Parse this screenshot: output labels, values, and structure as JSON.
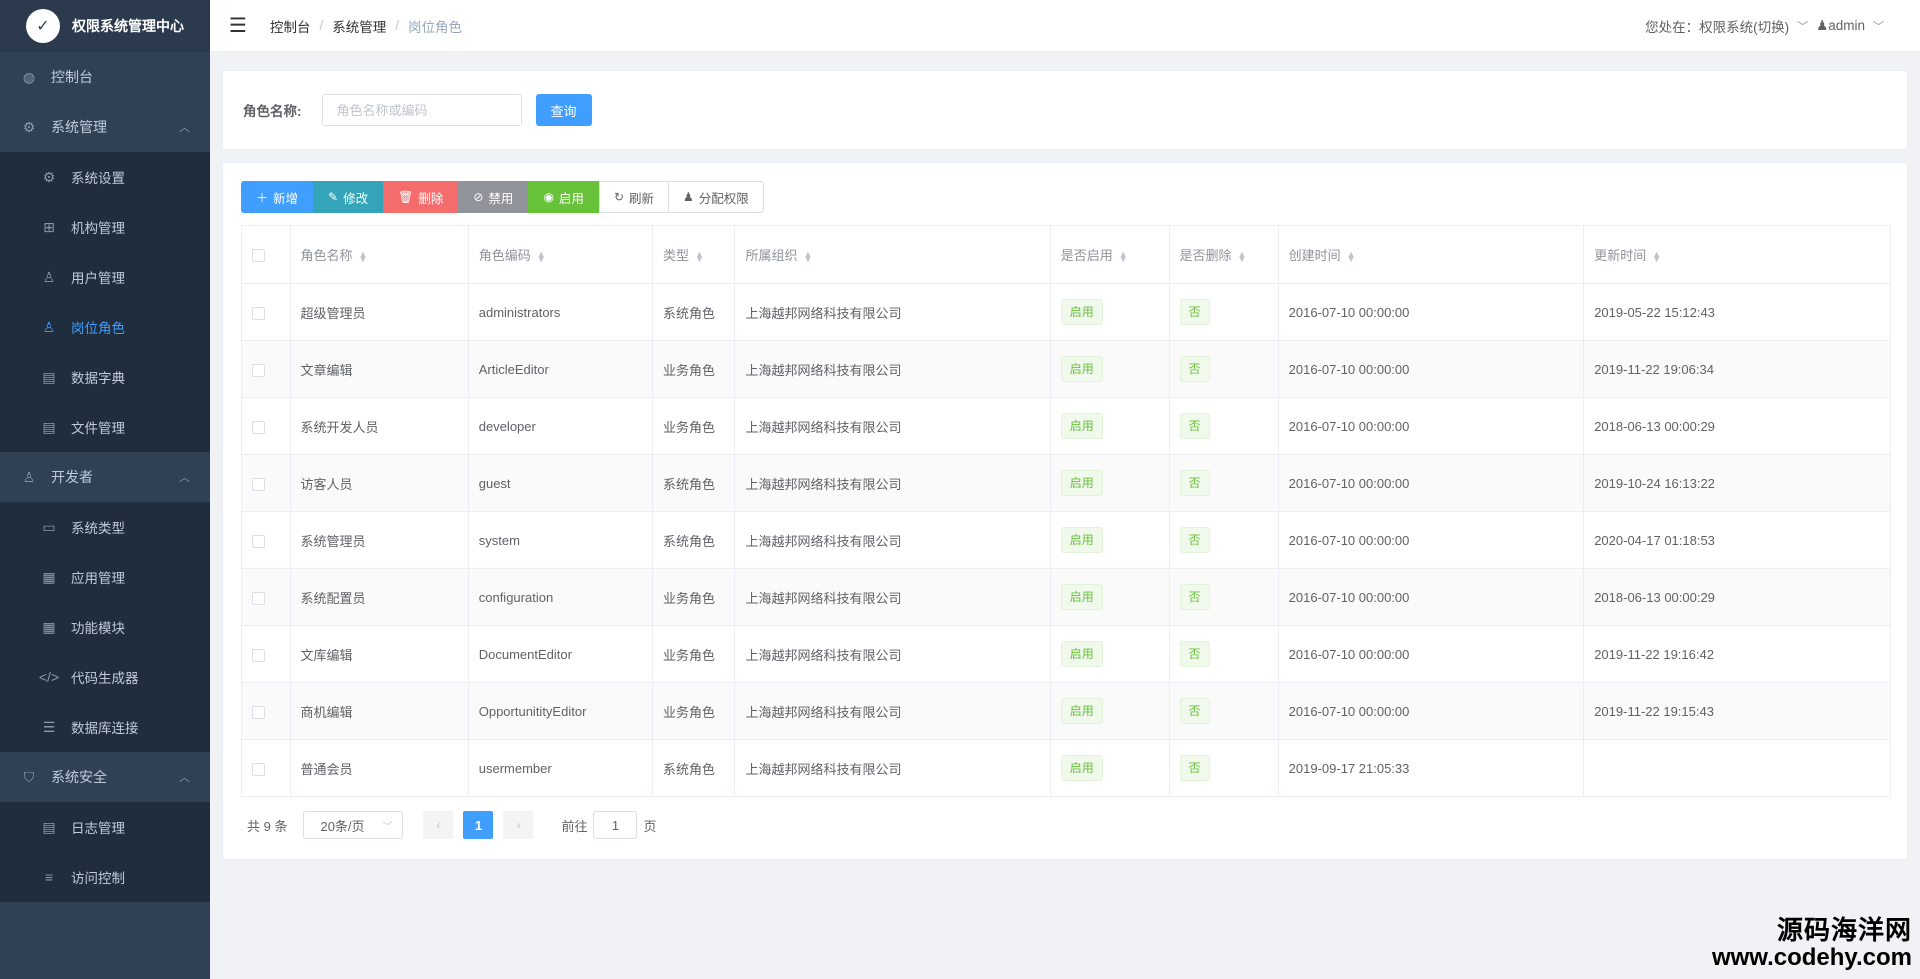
{
  "app": {
    "title": "权限系统管理中心",
    "logo_glyph": "✓"
  },
  "sidebar": {
    "groups": [
      {
        "label": "控制台",
        "icon": "dashboard-icon",
        "glyph": "◍",
        "items": []
      },
      {
        "label": "系统管理",
        "icon": "gear-icon",
        "glyph": "⚙",
        "expanded": true,
        "items": [
          {
            "label": "系统设置",
            "icon": "gear-icon",
            "glyph": "⚙"
          },
          {
            "label": "机构管理",
            "icon": "org-tree-icon",
            "glyph": "⊞"
          },
          {
            "label": "用户管理",
            "icon": "user-icon",
            "glyph": "♙"
          },
          {
            "label": "岗位角色",
            "icon": "person-icon",
            "glyph": "♙",
            "active": true
          },
          {
            "label": "数据字典",
            "icon": "document-icon",
            "glyph": "▤"
          },
          {
            "label": "文件管理",
            "icon": "file-icon",
            "glyph": "▤"
          }
        ]
      },
      {
        "label": "开发者",
        "icon": "developer-icon",
        "glyph": "♙",
        "expanded": true,
        "items": [
          {
            "label": "系统类型",
            "icon": "window-icon",
            "glyph": "▭"
          },
          {
            "label": "应用管理",
            "icon": "apps-icon",
            "glyph": "▦"
          },
          {
            "label": "功能模块",
            "icon": "modules-icon",
            "glyph": "▦"
          },
          {
            "label": "代码生成器",
            "icon": "code-icon",
            "glyph": "</>"
          },
          {
            "label": "数据库连接",
            "icon": "database-icon",
            "glyph": "☰"
          }
        ]
      },
      {
        "label": "系统安全",
        "icon": "shield-icon",
        "glyph": "⛉",
        "expanded": true,
        "items": [
          {
            "label": "日志管理",
            "icon": "log-icon",
            "glyph": "▤"
          },
          {
            "label": "访问控制",
            "icon": "sliders-icon",
            "glyph": "≡"
          }
        ]
      }
    ]
  },
  "header": {
    "breadcrumb": [
      "控制台",
      "系统管理",
      "岗位角色"
    ],
    "location_text": "您处在：权限系统(切换)",
    "user": "admin",
    "user_glyph": "♟"
  },
  "search": {
    "label": "角色名称:",
    "placeholder": "角色名称或编码",
    "button": "查询"
  },
  "toolbar": {
    "add": "新增",
    "edit": "修改",
    "delete": "删除",
    "disable": "禁用",
    "enable": "启用",
    "refresh": "刷新",
    "assign": "分配权限"
  },
  "table": {
    "columns": [
      "角色名称",
      "角色编码",
      "类型",
      "所属组织",
      "是否启用",
      "是否删除",
      "创建时间",
      "更新时间"
    ],
    "rows": [
      {
        "name": "超级管理员",
        "code": "administrators",
        "type": "系统角色",
        "org": "上海越邦网络科技有限公司",
        "enabled": "启用",
        "deleted": "否",
        "created": "2016-07-10 00:00:00",
        "updated": "2019-05-22 15:12:43"
      },
      {
        "name": "文章编辑",
        "code": "ArticleEditor",
        "type": "业务角色",
        "org": "上海越邦网络科技有限公司",
        "enabled": "启用",
        "deleted": "否",
        "created": "2016-07-10 00:00:00",
        "updated": "2019-11-22 19:06:34"
      },
      {
        "name": "系统开发人员",
        "code": "developer",
        "type": "业务角色",
        "org": "上海越邦网络科技有限公司",
        "enabled": "启用",
        "deleted": "否",
        "created": "2016-07-10 00:00:00",
        "updated": "2018-06-13 00:00:29"
      },
      {
        "name": "访客人员",
        "code": "guest",
        "type": "系统角色",
        "org": "上海越邦网络科技有限公司",
        "enabled": "启用",
        "deleted": "否",
        "created": "2016-07-10 00:00:00",
        "updated": "2019-10-24 16:13:22"
      },
      {
        "name": "系统管理员",
        "code": "system",
        "type": "系统角色",
        "org": "上海越邦网络科技有限公司",
        "enabled": "启用",
        "deleted": "否",
        "created": "2016-07-10 00:00:00",
        "updated": "2020-04-17 01:18:53"
      },
      {
        "name": "系统配置员",
        "code": "configuration",
        "type": "业务角色",
        "org": "上海越邦网络科技有限公司",
        "enabled": "启用",
        "deleted": "否",
        "created": "2016-07-10 00:00:00",
        "updated": "2018-06-13 00:00:29"
      },
      {
        "name": "文库编辑",
        "code": "DocumentEditor",
        "type": "业务角色",
        "org": "上海越邦网络科技有限公司",
        "enabled": "启用",
        "deleted": "否",
        "created": "2016-07-10 00:00:00",
        "updated": "2019-11-22 19:16:42"
      },
      {
        "name": "商机编辑",
        "code": "OpportunitityEditor",
        "type": "业务角色",
        "org": "上海越邦网络科技有限公司",
        "enabled": "启用",
        "deleted": "否",
        "created": "2016-07-10 00:00:00",
        "updated": "2019-11-22 19:15:43"
      },
      {
        "name": "普通会员",
        "code": "usermember",
        "type": "系统角色",
        "org": "上海越邦网络科技有限公司",
        "enabled": "启用",
        "deleted": "否",
        "created": "2019-09-17 21:05:33",
        "updated": ""
      }
    ]
  },
  "pagination": {
    "total": "共 9 条",
    "page_size": "20条/页",
    "current_page": "1",
    "goto_label": "前往",
    "goto_value": "1",
    "page_suffix": "页"
  },
  "watermark": {
    "name": "源码海洋网",
    "url": "www.codehy.com"
  }
}
